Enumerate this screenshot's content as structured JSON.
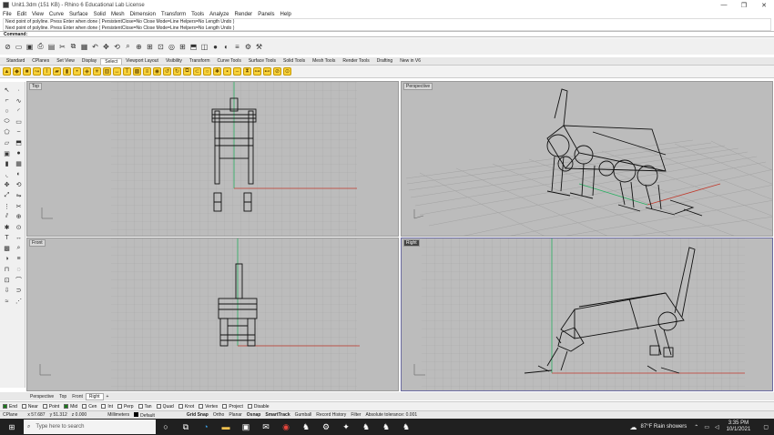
{
  "window": {
    "title": "Unit1.3dm (151 KB) - Rhino 6 Educational Lab License",
    "minimize": "—",
    "restore": "❐",
    "close": "✕"
  },
  "menu": [
    "File",
    "Edit",
    "View",
    "Curve",
    "Surface",
    "Solid",
    "Mesh",
    "Dimension",
    "Transform",
    "Tools",
    "Analyze",
    "Render",
    "Panels",
    "Help"
  ],
  "history": [
    "Next point of polyline. Press Enter when done ( PersistentClose=No  Close  Mode=Line  Helpers=No  Length  Undo )",
    "Next point of polyline. Press Enter when done ( PersistentClose=No  Close  Mode=Line  Helpers=No  Length  Undo )"
  ],
  "command": {
    "label": "Command:"
  },
  "toolbar_tabs": [
    "Standard",
    "CPlanes",
    "Set View",
    "Display",
    "Select",
    "Viewport Layout",
    "Visibility",
    "Transform",
    "Curve Tools",
    "Surface Tools",
    "Solid Tools",
    "Mesh Tools",
    "Render Tools",
    "Drafting",
    "New in V6"
  ],
  "active_toolbar_tab": "Select",
  "viewports": {
    "top": {
      "label": "Top"
    },
    "perspective": {
      "label": "Perspective"
    },
    "front": {
      "label": "Front"
    },
    "right": {
      "label": "Right"
    }
  },
  "viewport_tabs": [
    "Perspective",
    "Top",
    "Front",
    "Right"
  ],
  "active_viewport_tab": "Right",
  "viewport_tab_add": "+",
  "osnaps": [
    {
      "label": "End",
      "on": true
    },
    {
      "label": "Near",
      "on": false
    },
    {
      "label": "Point",
      "on": false
    },
    {
      "label": "Mid",
      "on": true
    },
    {
      "label": "Cen",
      "on": false
    },
    {
      "label": "Int",
      "on": false
    },
    {
      "label": "Perp",
      "on": false
    },
    {
      "label": "Tan",
      "on": false
    },
    {
      "label": "Quad",
      "on": false
    },
    {
      "label": "Knot",
      "on": false
    },
    {
      "label": "Vertex",
      "on": false
    },
    {
      "label": "Project",
      "on": false
    },
    {
      "label": "Disable",
      "on": false
    }
  ],
  "status": {
    "cplane": "CPlane",
    "x": "x 57.687",
    "y": "y 51.312",
    "z": "z 0.000",
    "units": "Millimeters",
    "layer": "Default",
    "toggles": [
      "Grid Snap",
      "Ortho",
      "Planar",
      "Osnap",
      "SmartTrack",
      "Gumball",
      "Record History",
      "Filter"
    ],
    "tolerance": "Absolute tolerance: 0.001"
  },
  "taskbar": {
    "search_placeholder": "Type here to search",
    "weather": "87°F  Rain showers",
    "time": "3:35 PM",
    "date": "10/1/2021"
  },
  "colors": {
    "x_axis": "#c0392b",
    "y_axis": "#27ae60",
    "grid": "#a8a8a8",
    "viewport_bg": "#bcbcbc"
  }
}
